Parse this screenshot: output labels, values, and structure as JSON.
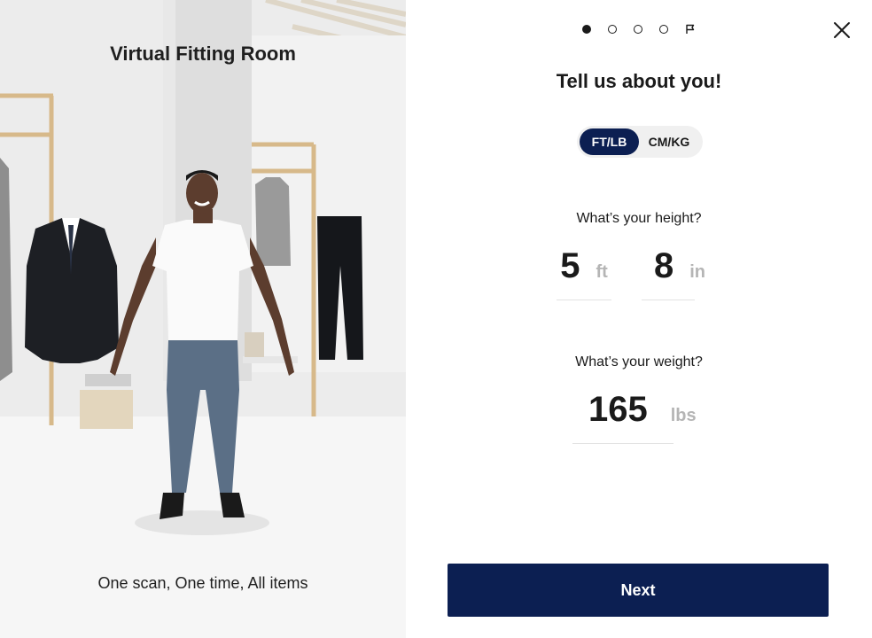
{
  "left_panel": {
    "title": "Virtual Fitting Room",
    "caption": "One scan, One time, All items"
  },
  "stepper": {
    "steps": [
      "active",
      "pending",
      "pending",
      "pending"
    ],
    "final_icon": "flag-icon"
  },
  "close": {
    "icon": "close-icon"
  },
  "form": {
    "heading": "Tell us about you!",
    "units": {
      "options": [
        "FT/LB",
        "CM/KG"
      ],
      "selected": "FT/LB"
    },
    "height": {
      "label": "What’s your height?",
      "feet_value": "5",
      "feet_unit": "ft",
      "inches_value": "8",
      "inches_unit": "in"
    },
    "weight": {
      "label": "What’s your weight?",
      "value": "165",
      "unit": "lbs"
    }
  },
  "next_button": {
    "label": "Next"
  },
  "colors": {
    "primary": "#0c1f52",
    "unit_text": "#b5b5b5",
    "toggle_bg": "#f0f0f0"
  }
}
